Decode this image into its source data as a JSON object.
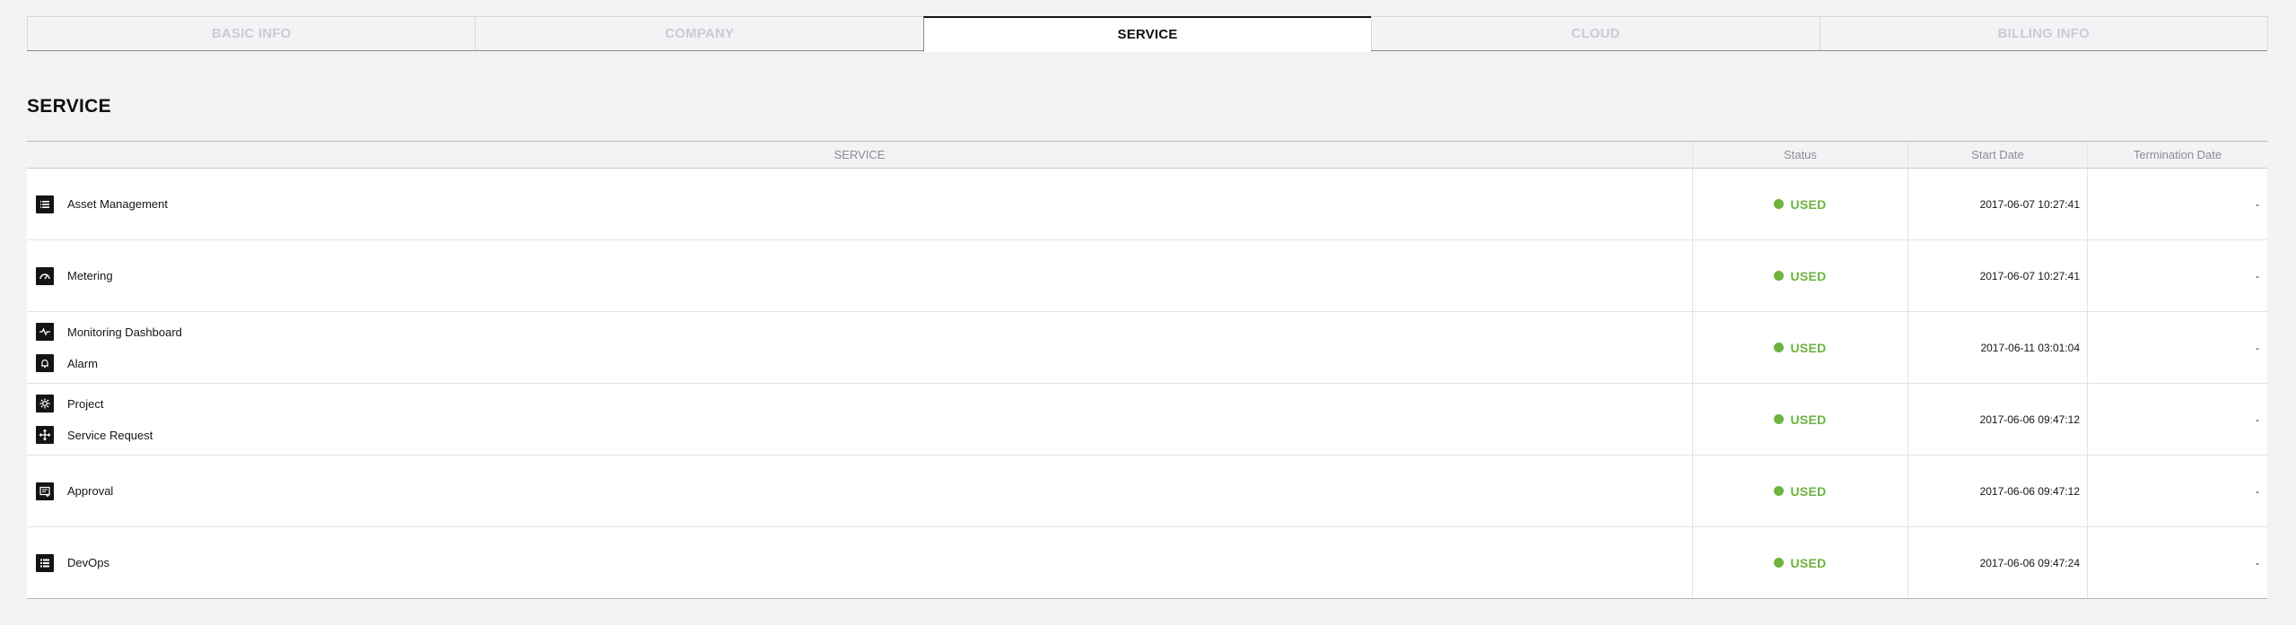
{
  "tabs": [
    {
      "label": "BASIC INFO",
      "active": false
    },
    {
      "label": "COMPANY",
      "active": false
    },
    {
      "label": "SERVICE",
      "active": true
    },
    {
      "label": "CLOUD",
      "active": false
    },
    {
      "label": "BILLING INFO",
      "active": false
    }
  ],
  "section_title": "SERVICE",
  "table": {
    "headers": {
      "service": "SERVICE",
      "status": "Status",
      "start_date": "Start Date",
      "termination_date": "Termination Date"
    },
    "status_color": "#6cb33f",
    "rows": [
      {
        "services": [
          {
            "label": "Asset Management",
            "icon": "asset-management-icon"
          }
        ],
        "status": "USED",
        "start_date": "2017-06-07 10:27:41",
        "termination_date": "-"
      },
      {
        "services": [
          {
            "label": "Metering",
            "icon": "gauge-icon"
          }
        ],
        "status": "USED",
        "start_date": "2017-06-07 10:27:41",
        "termination_date": "-"
      },
      {
        "services": [
          {
            "label": "Monitoring Dashboard",
            "icon": "pulse-icon"
          },
          {
            "label": "Alarm",
            "icon": "bell-icon"
          }
        ],
        "status": "USED",
        "start_date": "2017-06-11 03:01:04",
        "termination_date": "-"
      },
      {
        "services": [
          {
            "label": "Project",
            "icon": "gear-icon"
          },
          {
            "label": "Service Request",
            "icon": "move-arrows-icon"
          }
        ],
        "status": "USED",
        "start_date": "2017-06-06 09:47:12",
        "termination_date": "-"
      },
      {
        "services": [
          {
            "label": "Approval",
            "icon": "approval-icon"
          }
        ],
        "status": "USED",
        "start_date": "2017-06-06 09:47:12",
        "termination_date": "-"
      },
      {
        "services": [
          {
            "label": "DevOps",
            "icon": "devops-icon"
          }
        ],
        "status": "USED",
        "start_date": "2017-06-06 09:47:24",
        "termination_date": "-"
      }
    ]
  }
}
